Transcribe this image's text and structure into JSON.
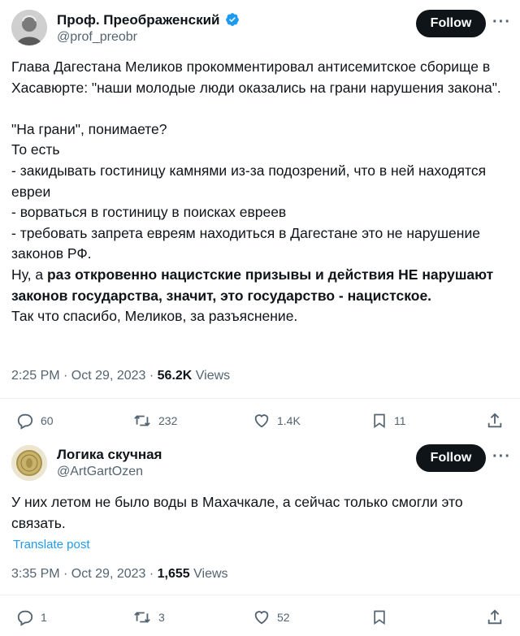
{
  "post1": {
    "author": {
      "name": "Проф. Преображенский",
      "handle": "@prof_preobr",
      "verified": true
    },
    "follow_label": "Follow",
    "more_label": "···",
    "text": {
      "line1": "Глава Дагестана Меликов прокомментировал антисемитское сборище в Хасавюрте: \"наши молодые люди оказались на грани нарушения закона\".",
      "line2": "\"На грани\", понимаете?",
      "line3": "То есть",
      "line4": "- закидывать гостиницу камнями из-за подозрений, что в ней находятся евреи",
      "line5": "- ворваться в гостиницу в поисках евреев",
      "line6": "- требовать запрета евреям находиться в Дагестане это не нарушение законов РФ.",
      "line7_start": "Ну, а ",
      "line7_bold": "раз откровенно нацистские призывы и действия НЕ нарушают законов государства, значит, это государство - нацистское.",
      "line8": "Так что спасибо, Меликов, за разъяснение."
    },
    "time": "2:25 PM · Oct 29, 2023 · ",
    "views_count": "56.2K",
    "views_label": " Views",
    "actions": {
      "replies": "60",
      "reposts": "232",
      "likes": "1.4K",
      "bookmarks": "11"
    }
  },
  "post2": {
    "author": {
      "name": "Логика скучная",
      "handle": "@ArtGartOzen"
    },
    "follow_label": "Follow",
    "more_label": "···",
    "text": "У них летом не было воды в Махачкале, а сейчас только смогли это связать.",
    "translate_label": "Translate post",
    "time": "3:35 PM · Oct 29, 2023 · ",
    "views_count": "1,655",
    "views_label": " Views",
    "actions": {
      "replies": "1",
      "reposts": "3",
      "likes": "52",
      "bookmarks": ""
    }
  },
  "colors": {
    "text": "#0f1419",
    "secondary": "#536471",
    "verified": "#1d9bf0",
    "link": "#1d9bf0",
    "button": "#0f1419"
  },
  "icons": [
    "verified-badge-icon",
    "reply-icon",
    "repost-icon",
    "like-icon",
    "bookmark-icon",
    "share-icon",
    "more-icon"
  ]
}
